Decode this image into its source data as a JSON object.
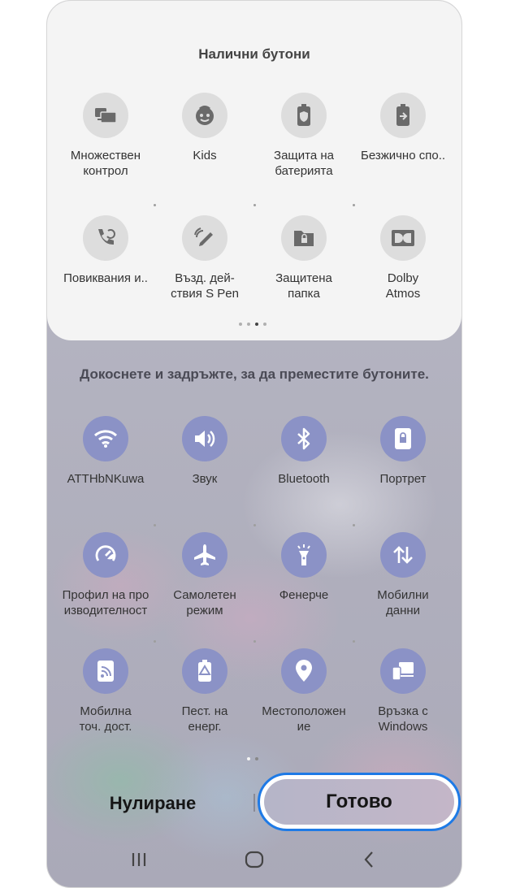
{
  "available": {
    "title": "Налични бутони",
    "tiles": [
      {
        "label": "Множествен\nконтрол",
        "icon": "multi-control-icon"
      },
      {
        "label": "Kids",
        "icon": "kids-face-icon"
      },
      {
        "label": "Защита на\nбатерията",
        "icon": "battery-shield-icon"
      },
      {
        "label": "Безжично спо..",
        "icon": "wireless-share-icon"
      },
      {
        "label": "Повиквания и..",
        "icon": "call-sync-icon"
      },
      {
        "label": "Възд. дей-\nствия S Pen",
        "icon": "s-pen-icon"
      },
      {
        "label": "Защитена\nпапка",
        "icon": "secure-folder-icon"
      },
      {
        "label": "Dolby\nAtmos",
        "icon": "dolby-icon"
      }
    ]
  },
  "hint": "Докоснете и задръжте, за да преместите бутоните.",
  "active": {
    "tiles": [
      {
        "label": "ATTHbNKuwa",
        "icon": "wifi-icon"
      },
      {
        "label": "Звук",
        "icon": "sound-icon"
      },
      {
        "label": "Bluetooth",
        "icon": "bluetooth-icon"
      },
      {
        "label": "Портрет",
        "icon": "portrait-lock-icon"
      },
      {
        "label": "Профил на про\nизводителност",
        "icon": "performance-profile-icon"
      },
      {
        "label": "Самолетен\nрежим",
        "icon": "airplane-icon"
      },
      {
        "label": "Фенерче",
        "icon": "flashlight-icon"
      },
      {
        "label": "Мобилни\nданни",
        "icon": "mobile-data-icon"
      },
      {
        "label": "Мобилна\nточ. дост.",
        "icon": "hotspot-icon"
      },
      {
        "label": "Пест. на\nенерг.",
        "icon": "power-saving-icon"
      },
      {
        "label": "Местоположен\nие",
        "icon": "location-icon"
      },
      {
        "label": "Връзка с\nWindows",
        "icon": "link-to-windows-icon"
      }
    ]
  },
  "buttons": {
    "reset": "Нулиране",
    "done": "Готово"
  },
  "colors": {
    "accent": "#1e7ae6",
    "active_icon_bg": "#8b92c6"
  }
}
